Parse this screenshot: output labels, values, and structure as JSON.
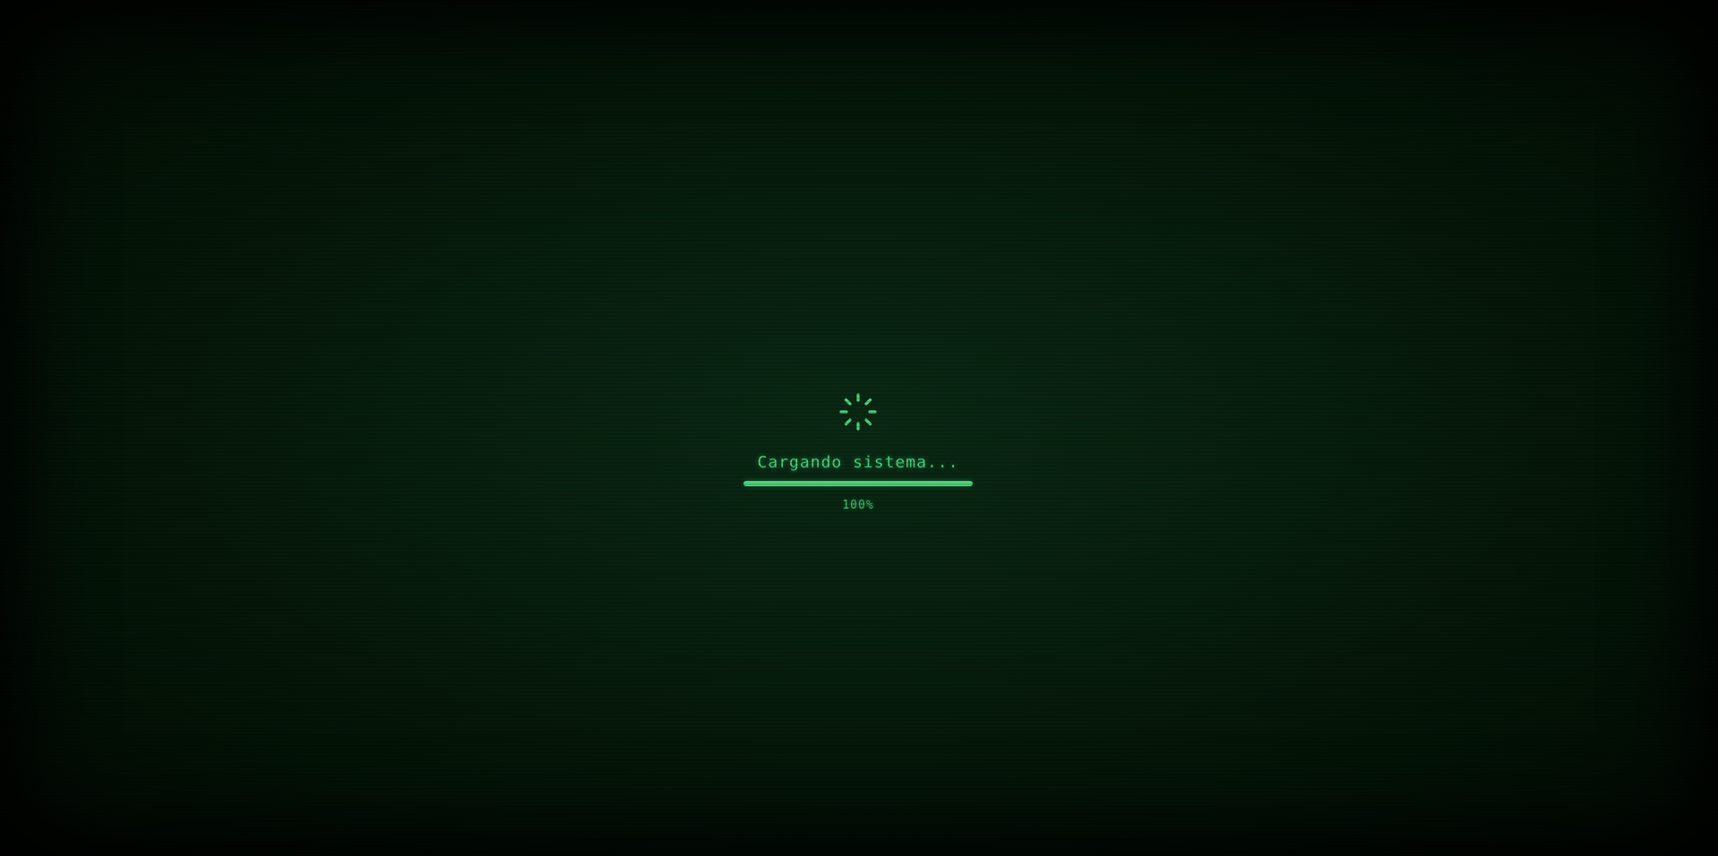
{
  "loader": {
    "message": "Cargando sistema...",
    "percent_label": "100%",
    "progress_fraction": 1.0,
    "spinner_icon": "loading-spinner-icon"
  },
  "colors": {
    "accent": "#4cd77e",
    "background": "#071f0e"
  }
}
